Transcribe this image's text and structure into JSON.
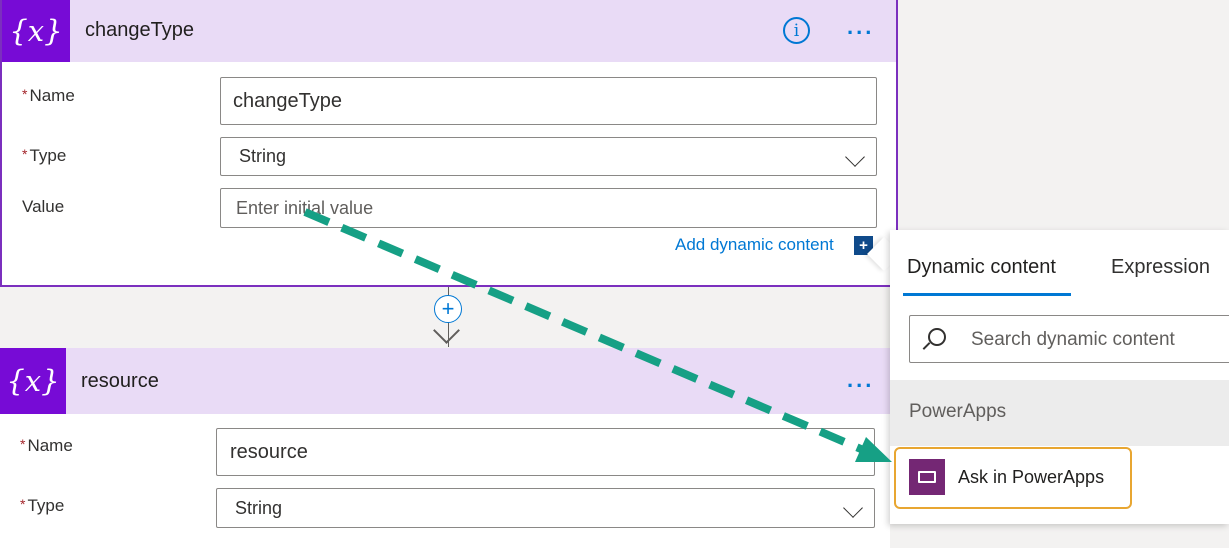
{
  "card1": {
    "title": "changeType",
    "icon": "variable-icon",
    "icon_text": "{x}",
    "info_glyph": "i",
    "more_glyph": "...",
    "fields": {
      "name_label": "Name",
      "name_value": "changeType",
      "type_label": "Type",
      "type_value": "String",
      "value_label": "Value",
      "value_placeholder": "Enter initial value"
    },
    "add_dynamic_label": "Add dynamic content",
    "add_dynamic_glyph": "+"
  },
  "connector": {
    "plus_glyph": "+"
  },
  "card2": {
    "title": "resource",
    "icon": "variable-icon",
    "icon_text": "{x}",
    "more_glyph": "...",
    "fields": {
      "name_label": "Name",
      "name_value": "resource",
      "type_label": "Type",
      "type_value": "String"
    }
  },
  "required_mark": "*",
  "dynamic_panel": {
    "tabs": [
      "Dynamic content",
      "Expression"
    ],
    "active_tab": "Dynamic content",
    "search_placeholder": "Search dynamic content",
    "group_label": "PowerApps",
    "item_label": "Ask in PowerApps"
  },
  "colors": {
    "header_bg": "#e9dbf6",
    "icon_bg": "#770bd6",
    "accent": "#0078d4",
    "card_border": "#7b2fbe",
    "arrow": "#16a085",
    "highlight": "#e8a631",
    "powerapps": "#742774"
  }
}
